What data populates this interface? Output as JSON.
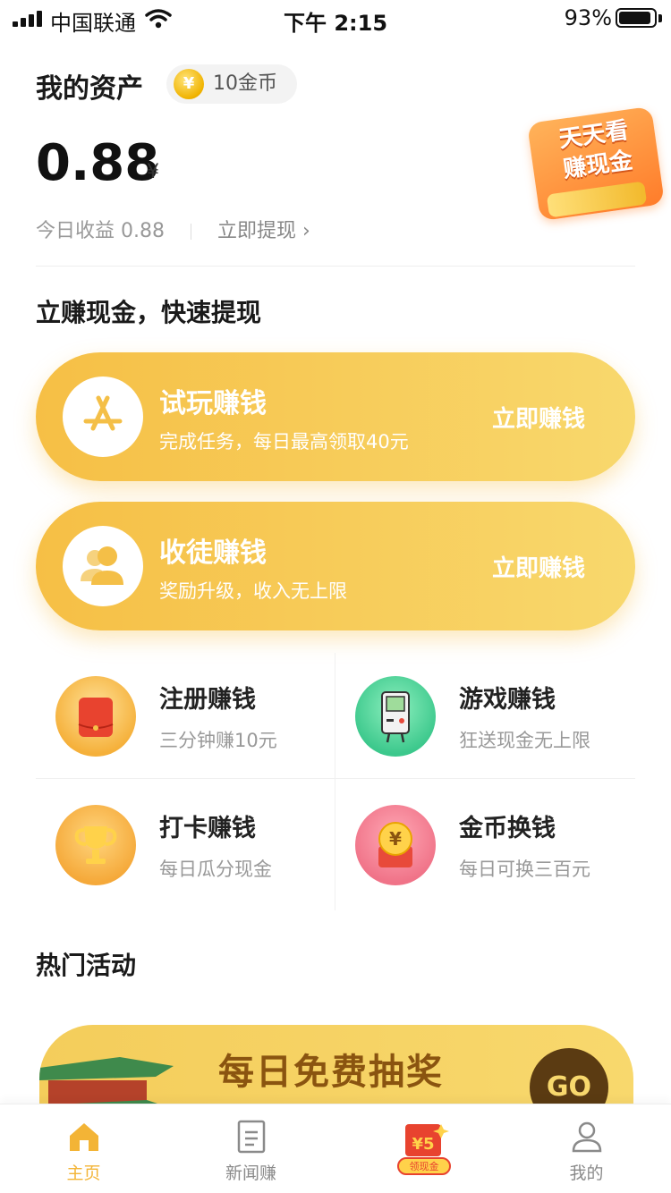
{
  "status_bar": {
    "carrier": "中国联通",
    "time": "下午 2:15",
    "battery": "93%",
    "battery_level": 0.93
  },
  "assets": {
    "title": "我的资产",
    "coins": "10金币",
    "coin_symbol": "¥",
    "balance": "0.88",
    "currency": "¥",
    "today_label": "今日收益 0.88",
    "withdraw": "立即提现 ›",
    "promo_badge": "天天看\n赚现金"
  },
  "earn_section": {
    "title": "立赚现金，快速提现",
    "cards": [
      {
        "title": "试玩赚钱",
        "subtitle": "完成任务，每日最高领取40元",
        "action": "立即赚钱",
        "icon": "app-store-icon"
      },
      {
        "title": "收徒赚钱",
        "subtitle": "奖励升级，收入无上限",
        "action": "立即赚钱",
        "icon": "user-icon"
      }
    ]
  },
  "grid": [
    {
      "title": "注册赚钱",
      "subtitle": "三分钟赚10元",
      "icon": "red-envelope-icon",
      "color": "#f5b03a"
    },
    {
      "title": "游戏赚钱",
      "subtitle": "狂送现金无上限",
      "icon": "game-console-icon",
      "color": "#3cc88c"
    },
    {
      "title": "打卡赚钱",
      "subtitle": "每日瓜分现金",
      "icon": "trophy-icon",
      "color": "#f5b03a"
    },
    {
      "title": "金币换钱",
      "subtitle": "每日可换三百元",
      "icon": "coin-exchange-icon",
      "color": "#f07388"
    }
  ],
  "hot_section": {
    "title": "热门活动",
    "banner_title": "每日免费抽奖",
    "banner_action": "GO"
  },
  "tabbar": {
    "tabs": [
      {
        "label": "主页",
        "icon": "home-icon",
        "active": true
      },
      {
        "label": "新闻赚",
        "icon": "news-icon",
        "active": false
      },
      {
        "label": "",
        "icon": "red-envelope-icon",
        "active": false,
        "badge_value": "¥5",
        "badge_label": "领现金"
      },
      {
        "label": "我的",
        "icon": "profile-icon",
        "active": false
      }
    ]
  },
  "colors": {
    "accent": "#f6bf45",
    "accent_light": "#f8d86d",
    "active_tab": "#f3b436"
  }
}
